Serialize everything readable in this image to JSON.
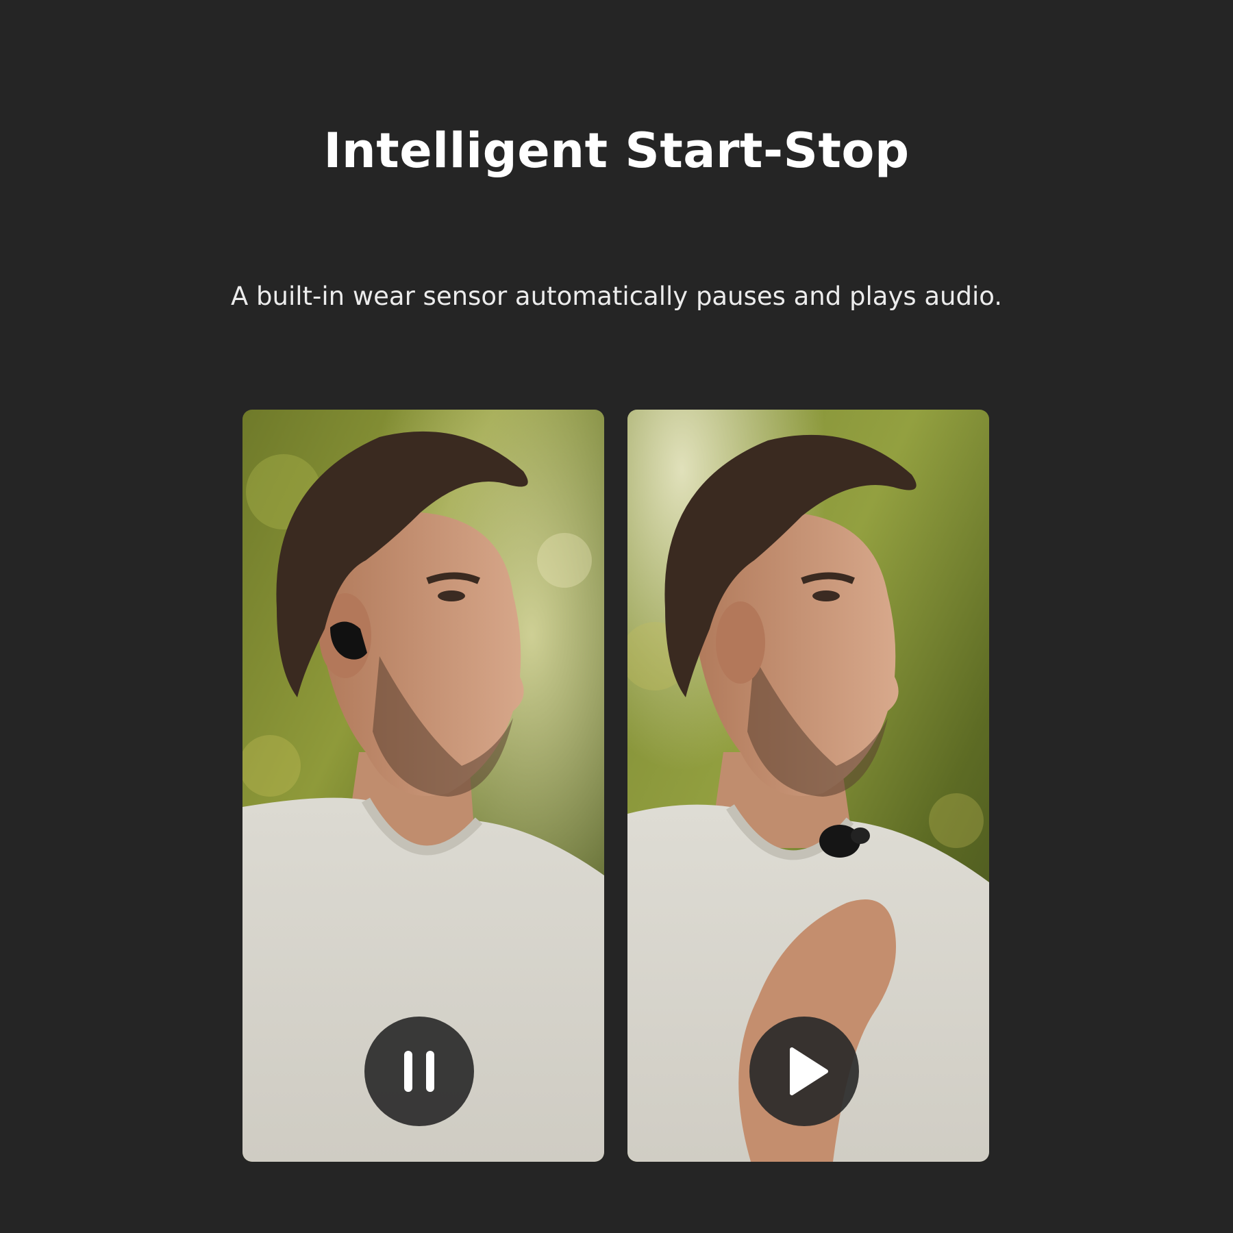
{
  "header": {
    "title": "Intelligent Start-Stop",
    "subtitle": "A built-in wear sensor automatically pauses and plays audio."
  },
  "panels": [
    {
      "photo": "man-wearing-earbud-photo",
      "state_icon": "pause-icon"
    },
    {
      "photo": "man-removing-earbud-photo",
      "state_icon": "play-icon"
    }
  ],
  "colors": {
    "background": "#252525",
    "title_text": "#ffffff",
    "button_fill": "#2a2a2a",
    "button_icon": "#ffffff"
  }
}
